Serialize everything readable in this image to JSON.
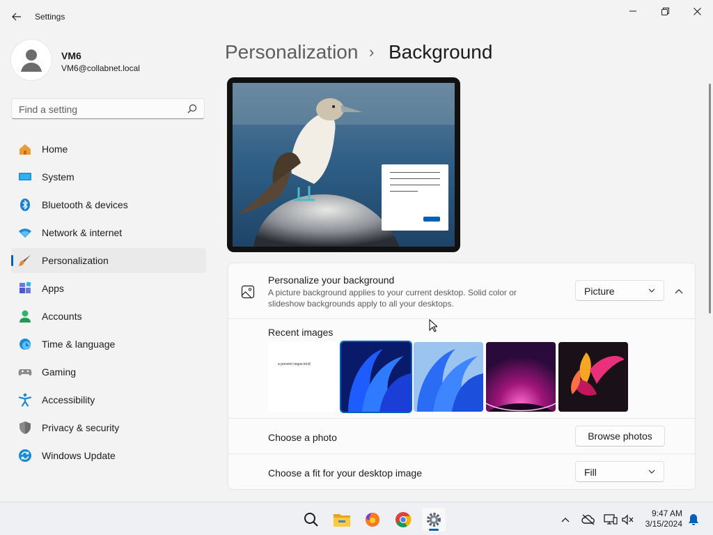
{
  "window": {
    "title": "Settings"
  },
  "user": {
    "name": "VM6",
    "email": "VM6@collabnet.local"
  },
  "search": {
    "placeholder": "Find a setting"
  },
  "nav": {
    "items": [
      {
        "label": "Home",
        "icon": "home-icon"
      },
      {
        "label": "System",
        "icon": "system-icon"
      },
      {
        "label": "Bluetooth & devices",
        "icon": "bluetooth-icon"
      },
      {
        "label": "Network & internet",
        "icon": "wifi-icon"
      },
      {
        "label": "Personalization",
        "icon": "brush-icon",
        "active": true
      },
      {
        "label": "Apps",
        "icon": "apps-icon"
      },
      {
        "label": "Accounts",
        "icon": "accounts-icon"
      },
      {
        "label": "Time & language",
        "icon": "clock-globe-icon"
      },
      {
        "label": "Gaming",
        "icon": "gamepad-icon"
      },
      {
        "label": "Accessibility",
        "icon": "accessibility-icon"
      },
      {
        "label": "Privacy & security",
        "icon": "shield-icon"
      },
      {
        "label": "Windows Update",
        "icon": "update-icon"
      }
    ]
  },
  "breadcrumb": {
    "parent": "Personalization",
    "separator": "›",
    "current": "Background"
  },
  "background_card": {
    "title": "Personalize your background",
    "description": "A picture background applies to your current desktop. Solid color or slideshow backgrounds apply to all your desktops.",
    "type_value": "Picture",
    "recent_label": "Recent images",
    "thumbnail_text": "a present vegas trick!",
    "choose_photo_label": "Choose a photo",
    "browse_button": "Browse photos",
    "fit_label": "Choose a fit for your desktop image",
    "fit_value": "Fill"
  },
  "taskbar": {
    "apps": [
      "search-icon",
      "file-explorer-icon",
      "firefox-icon",
      "chrome-icon",
      "settings-gear-icon"
    ],
    "time": "9:47 AM",
    "date": "3/15/2024"
  },
  "colors": {
    "accent": "#005fb8",
    "background": "#f3f3f3",
    "card": "#fbfbfb"
  }
}
